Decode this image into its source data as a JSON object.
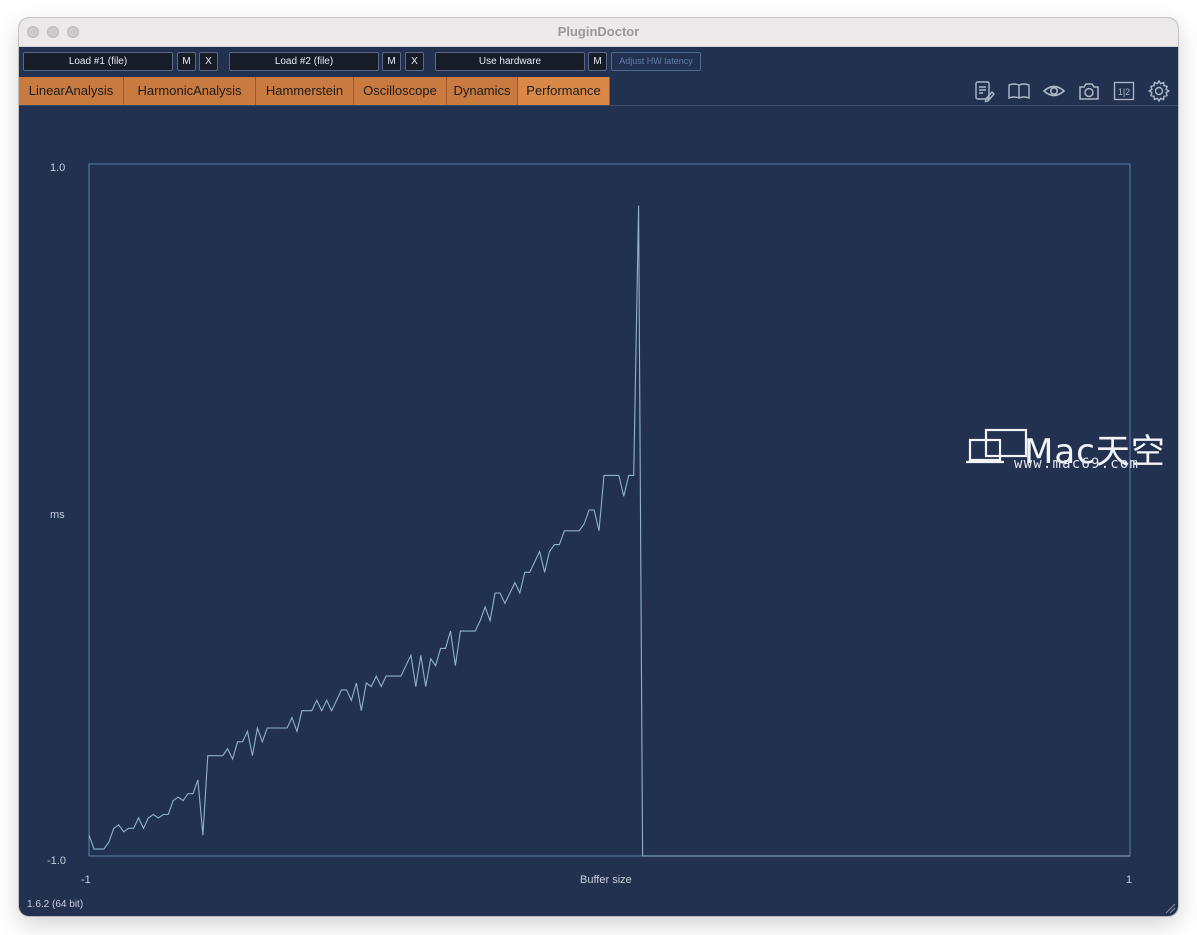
{
  "window": {
    "title": "PluginDoctor"
  },
  "controls": {
    "load1": "Load #1 (file)",
    "load2": "Load #2 (file)",
    "hardware": "Use hardware",
    "m_label": "M",
    "x_label": "X",
    "adjust_latency": "Adjust HW latency"
  },
  "tabs": [
    {
      "label": "LinearAnalysis"
    },
    {
      "label": "HarmonicAnalysis"
    },
    {
      "label": "Hammerstein"
    },
    {
      "label": "Oscilloscope"
    },
    {
      "label": "Dynamics"
    },
    {
      "label": "Performance",
      "active": true
    }
  ],
  "toolbar_icons": [
    "notes-edit-icon",
    "book-icon",
    "eye-icon",
    "camera-icon",
    "split-1-2-icon",
    "gear-icon"
  ],
  "toolbar_text": {
    "split": "1|2"
  },
  "colors": {
    "background": "#233150",
    "tab_orange": "#c97a40",
    "plot_line": "#8fb3cc",
    "plot_frame": "#5b84a8"
  },
  "chart_data": {
    "type": "line",
    "ylabel": "ms",
    "xlabel": "Buffer size",
    "y_ticks": [
      "1.0",
      "-1.0"
    ],
    "x_ticks": [
      "-1",
      "1"
    ],
    "ylim": [
      -1.0,
      1.0
    ],
    "xlim": [
      -1,
      1
    ],
    "series": [
      {
        "values": [
          -0.94,
          -0.98,
          -0.98,
          -0.98,
          -0.96,
          -0.92,
          -0.91,
          -0.93,
          -0.92,
          -0.92,
          -0.89,
          -0.92,
          -0.89,
          -0.88,
          -0.89,
          -0.88,
          -0.88,
          -0.84,
          -0.83,
          -0.84,
          -0.82,
          -0.82,
          -0.78,
          -0.94,
          -0.71,
          -0.71,
          -0.71,
          -0.71,
          -0.69,
          -0.72,
          -0.67,
          -0.67,
          -0.64,
          -0.71,
          -0.63,
          -0.67,
          -0.63,
          -0.63,
          -0.63,
          -0.63,
          -0.63,
          -0.6,
          -0.64,
          -0.58,
          -0.58,
          -0.58,
          -0.55,
          -0.58,
          -0.55,
          -0.58,
          -0.55,
          -0.52,
          -0.52,
          -0.55,
          -0.5,
          -0.58,
          -0.5,
          -0.51,
          -0.48,
          -0.51,
          -0.48,
          -0.48,
          -0.48,
          -0.48,
          -0.45,
          -0.42,
          -0.51,
          -0.42,
          -0.51,
          -0.43,
          -0.45,
          -0.4,
          -0.4,
          -0.35,
          -0.45,
          -0.35,
          -0.35,
          -0.35,
          -0.35,
          -0.32,
          -0.28,
          -0.32,
          -0.24,
          -0.24,
          -0.27,
          -0.24,
          -0.21,
          -0.24,
          -0.18,
          -0.18,
          -0.15,
          -0.12,
          -0.18,
          -0.12,
          -0.1,
          -0.1,
          -0.06,
          -0.06,
          -0.06,
          -0.06,
          -0.04,
          0.0,
          0.0,
          -0.06,
          0.1,
          0.1,
          0.1,
          0.1,
          0.04,
          0.1,
          0.1,
          0.88
        ]
      }
    ]
  },
  "version": "1.6.2 (64 bit)",
  "watermark": {
    "brand": "Mac天空",
    "url": "www.mac69.com"
  }
}
